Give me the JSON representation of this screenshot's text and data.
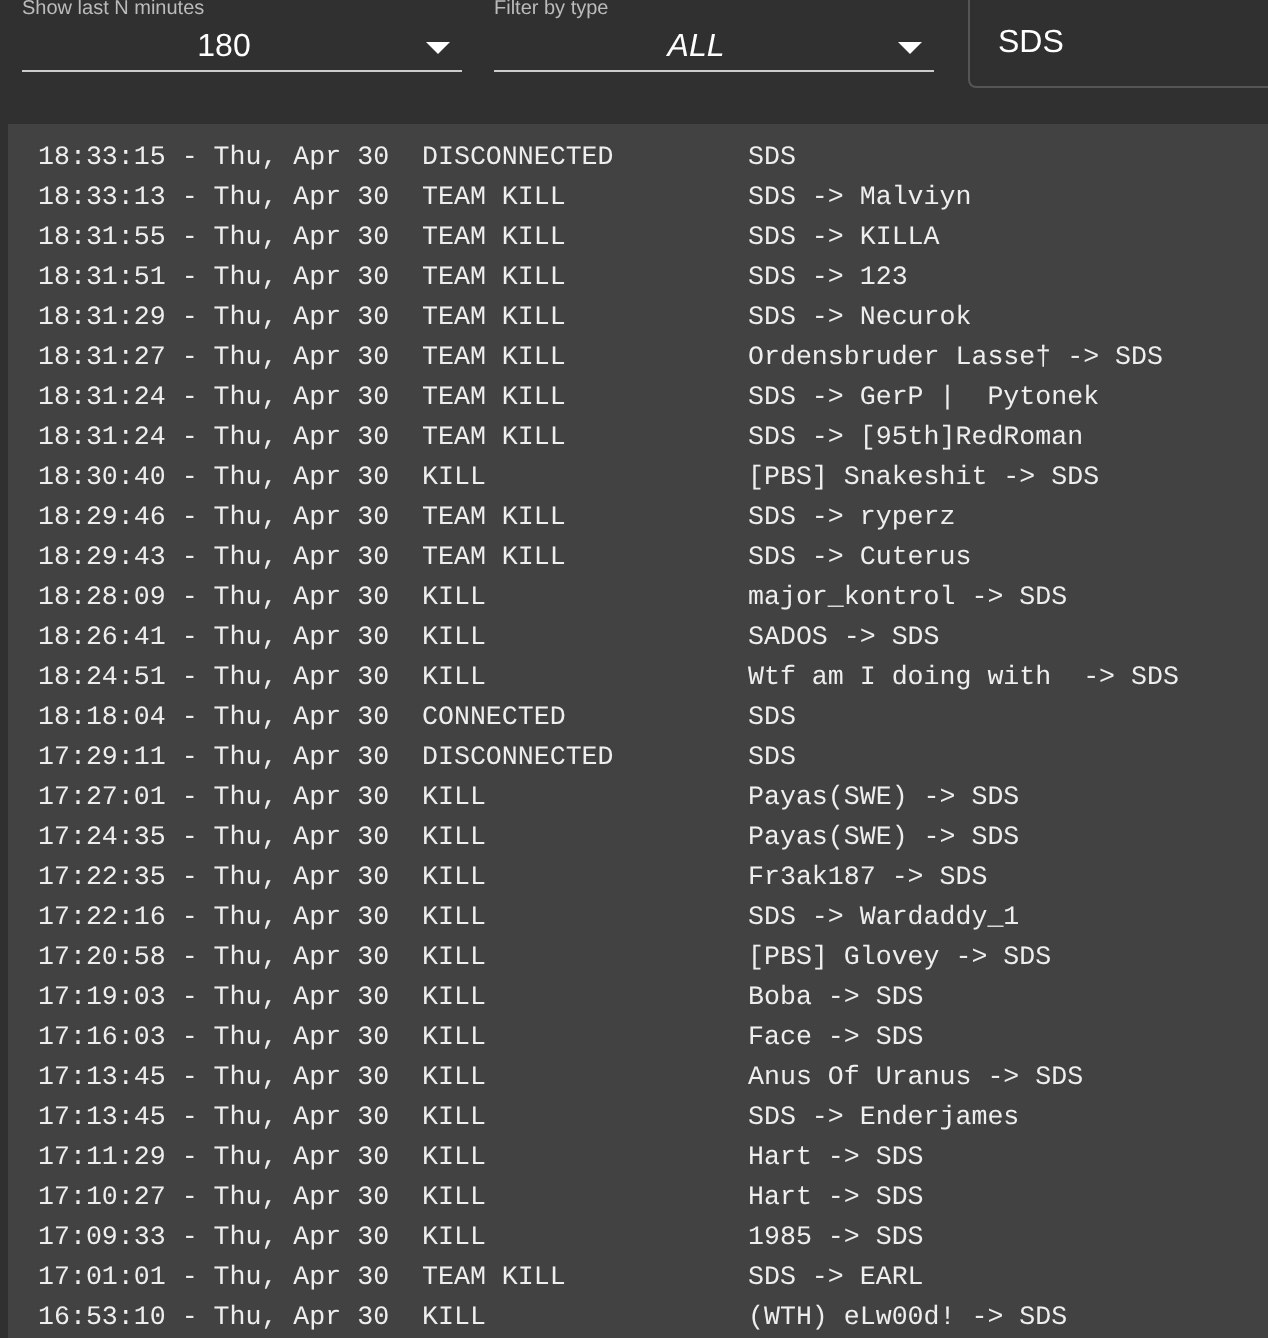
{
  "filters": [
    {
      "kind": "select",
      "label": "Show last N minutes",
      "value": "180",
      "italic": false
    },
    {
      "kind": "select",
      "label": "Filter by type",
      "value": "ALL",
      "italic": true
    }
  ],
  "search": {
    "value": "SDS"
  },
  "log": [
    {
      "time": "18:33:15 - Thu, Apr 30",
      "type": "DISCONNECTED",
      "message": "SDS"
    },
    {
      "time": "18:33:13 - Thu, Apr 30",
      "type": "TEAM KILL",
      "message": "SDS -> Malviyn"
    },
    {
      "time": "18:31:55 - Thu, Apr 30",
      "type": "TEAM KILL",
      "message": "SDS -> KILLA"
    },
    {
      "time": "18:31:51 - Thu, Apr 30",
      "type": "TEAM KILL",
      "message": "SDS -> 123"
    },
    {
      "time": "18:31:29 - Thu, Apr 30",
      "type": "TEAM KILL",
      "message": "SDS -> Necurok"
    },
    {
      "time": "18:31:27 - Thu, Apr 30",
      "type": "TEAM KILL",
      "message": "Ordensbruder Lasse† -> SDS"
    },
    {
      "time": "18:31:24 - Thu, Apr 30",
      "type": "TEAM KILL",
      "message": "SDS -> GerP |  Pytonek"
    },
    {
      "time": "18:31:24 - Thu, Apr 30",
      "type": "TEAM KILL",
      "message": "SDS -> [95th]RedRoman"
    },
    {
      "time": "18:30:40 - Thu, Apr 30",
      "type": "KILL",
      "message": "[PBS] Snakeshit -> SDS"
    },
    {
      "time": "18:29:46 - Thu, Apr 30",
      "type": "TEAM KILL",
      "message": "SDS -> ryperz"
    },
    {
      "time": "18:29:43 - Thu, Apr 30",
      "type": "TEAM KILL",
      "message": "SDS -> Cuterus"
    },
    {
      "time": "18:28:09 - Thu, Apr 30",
      "type": "KILL",
      "message": "major_kontrol -> SDS"
    },
    {
      "time": "18:26:41 - Thu, Apr 30",
      "type": "KILL",
      "message": "SADOS -> SDS"
    },
    {
      "time": "18:24:51 - Thu, Apr 30",
      "type": "KILL",
      "message": "Wtf am I doing with  -> SDS"
    },
    {
      "time": "18:18:04 - Thu, Apr 30",
      "type": "CONNECTED",
      "message": "SDS"
    },
    {
      "time": "17:29:11 - Thu, Apr 30",
      "type": "DISCONNECTED",
      "message": "SDS"
    },
    {
      "time": "17:27:01 - Thu, Apr 30",
      "type": "KILL",
      "message": "Payas(SWE) -> SDS"
    },
    {
      "time": "17:24:35 - Thu, Apr 30",
      "type": "KILL",
      "message": "Payas(SWE) -> SDS"
    },
    {
      "time": "17:22:35 - Thu, Apr 30",
      "type": "KILL",
      "message": "Fr3ak187 -> SDS"
    },
    {
      "time": "17:22:16 - Thu, Apr 30",
      "type": "KILL",
      "message": "SDS -> Wardaddy_1"
    },
    {
      "time": "17:20:58 - Thu, Apr 30",
      "type": "KILL",
      "message": "[PBS] Glovey -> SDS"
    },
    {
      "time": "17:19:03 - Thu, Apr 30",
      "type": "KILL",
      "message": "Boba -> SDS"
    },
    {
      "time": "17:16:03 - Thu, Apr 30",
      "type": "KILL",
      "message": "Face -> SDS"
    },
    {
      "time": "17:13:45 - Thu, Apr 30",
      "type": "KILL",
      "message": "Anus Of Uranus -> SDS"
    },
    {
      "time": "17:13:45 - Thu, Apr 30",
      "type": "KILL",
      "message": "SDS -> Enderjames"
    },
    {
      "time": "17:11:29 - Thu, Apr 30",
      "type": "KILL",
      "message": "Hart -> SDS"
    },
    {
      "time": "17:10:27 - Thu, Apr 30",
      "type": "KILL",
      "message": "Hart -> SDS"
    },
    {
      "time": "17:09:33 - Thu, Apr 30",
      "type": "KILL",
      "message": "1985 -> SDS"
    },
    {
      "time": "17:01:01 - Thu, Apr 30",
      "type": "TEAM KILL",
      "message": "SDS -> EARL"
    },
    {
      "time": "16:53:10 - Thu, Apr 30",
      "type": "KILL",
      "message": "(WTH) eLw00d! -> SDS"
    }
  ]
}
